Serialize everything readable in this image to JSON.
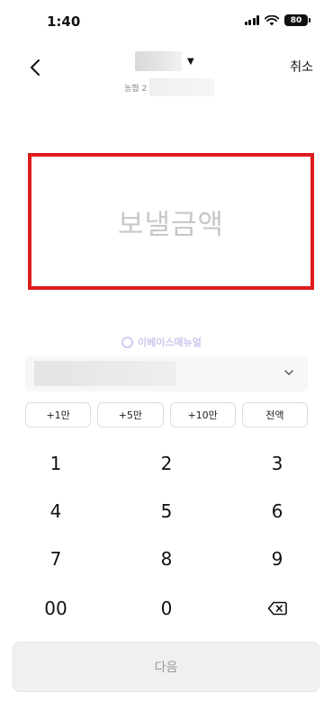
{
  "status_bar": {
    "time": "1:40",
    "battery": "80"
  },
  "header": {
    "bank_prefix": "농협 2",
    "cancel_label": "취소"
  },
  "amount": {
    "placeholder": "보낼금액"
  },
  "watermark": {
    "text": "이베이스매뉴얼"
  },
  "quick_amounts": [
    "+1만",
    "+5만",
    "+10만",
    "전액"
  ],
  "keypad": {
    "keys": [
      "1",
      "2",
      "3",
      "4",
      "5",
      "6",
      "7",
      "8",
      "9",
      "00",
      "0"
    ],
    "backspace_icon": "backspace-icon"
  },
  "next_label": "다음",
  "colors": {
    "highlight": "#dd1b1b",
    "disabled_text": "#9a9a9a",
    "placeholder": "#c8c8c8"
  }
}
